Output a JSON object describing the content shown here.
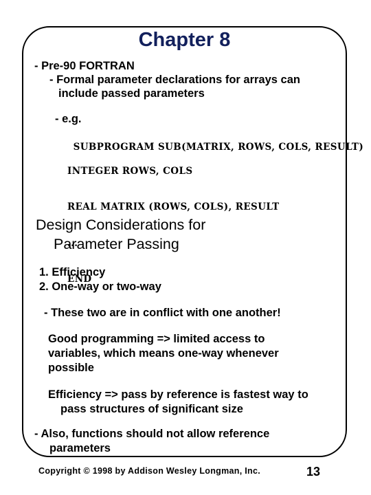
{
  "slide": {
    "title": "Chapter 8",
    "title_color": "#12205c",
    "frame_border_color": "#000000",
    "background_color": "#ffffff"
  },
  "bullets": {
    "pre90": "- Pre-90 FORTRAN",
    "formal_line1": "- Formal parameter declarations for arrays can",
    "formal_line2": "include passed parameters",
    "eg": "- e.g."
  },
  "code": {
    "line1": "SUBPROGRAM SUB(MATRIX, ROWS, COLS, RESULT)",
    "line2": "INTEGER ROWS, COLS",
    "line3": "REAL MATRIX (ROWS, COLS), RESULT",
    "line4": "...",
    "line5": "END"
  },
  "heading": {
    "line1": "Design Considerations for",
    "line2": "Parameter Passing"
  },
  "numbered_list": [
    "1. Efficiency",
    "2. One-way or two-way"
  ],
  "notes": {
    "conflict": "- These two are in conflict with one another!",
    "good_line1": "Good programming => limited access to",
    "good_line2": "variables, which means one-way whenever",
    "good_line3": "possible",
    "efficiency_line1": "Efficiency => pass by reference is fastest way to",
    "efficiency_line2": "pass structures of significant size",
    "also_line1": "- Also, functions should not allow reference",
    "also_line2": "parameters"
  },
  "footer": {
    "copyright": "Copyright © 1998 by Addison Wesley Longman, Inc.",
    "page_number": "13"
  }
}
